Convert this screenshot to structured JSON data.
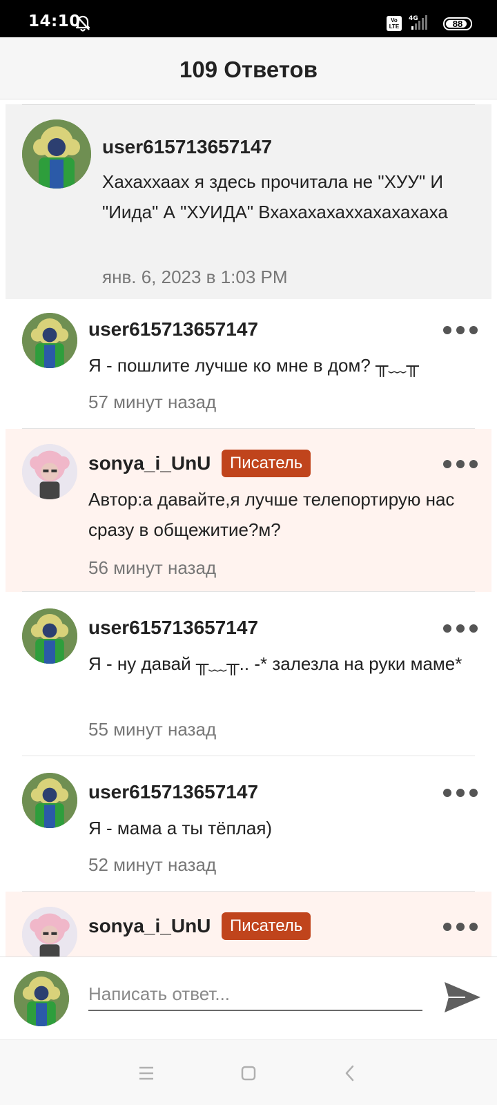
{
  "status_bar": {
    "time": "14:10",
    "volte": "Vo\nLTE",
    "network": "4G",
    "battery": "88",
    "battery_level": 0.88
  },
  "header": {
    "title": "109 Ответов"
  },
  "parent_comment": {
    "username": "user615713657147",
    "text": "Хахаххаах я здесь прочитала не \"ХУУ\" И \"Иида\" А \"ХУИДА\" Вхахахахаххахахахаха",
    "time": "янв. 6, 2023 в 1:03 PM"
  },
  "replies": [
    {
      "username": "user615713657147",
      "text": "Я - пошлите лучше ко мне в дом? ╥﹏╥",
      "time": "57 минут назад"
    },
    {
      "username": "sonya_i_UnU",
      "badge": "Писатель",
      "text": "Автор:а давайте,я лучше телепортирую нас сразу в общежитие?м?",
      "time": "56 минут назад"
    },
    {
      "username": "user615713657147",
      "text": "Я - ну давай ╥﹏╥.. -* залезла на руки маме*",
      "time": "55 минут назад"
    },
    {
      "username": "user615713657147",
      "text": "Я - мама а ты тёплая)",
      "time": "52 минут назад"
    },
    {
      "username": "sonya_i_UnU",
      "badge": "Писатель",
      "text": "",
      "time": ""
    }
  ],
  "compose": {
    "placeholder": "Написать ответ..."
  },
  "icons": {
    "dnd": "bell-off-icon",
    "signal": "signal-icon",
    "more": "more-horizontal-icon",
    "send": "send-icon",
    "menu": "menu-icon",
    "home": "home-square-icon",
    "back": "back-chevron-icon"
  },
  "colors": {
    "badge": "#c0441c",
    "author_highlight": "#fff3ef",
    "parent_bg": "#f2f2f2"
  }
}
